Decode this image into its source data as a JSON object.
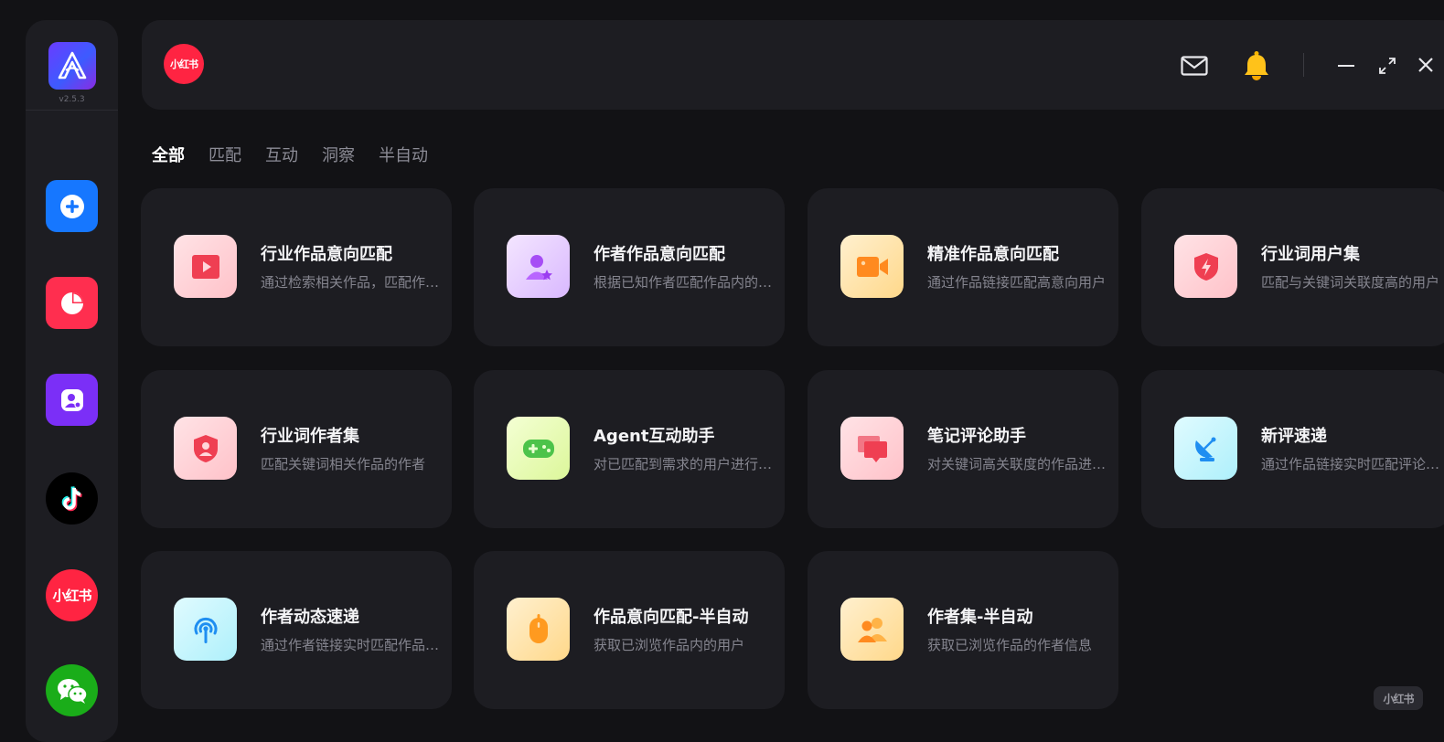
{
  "app": {
    "version": "v2.5.3",
    "brand_color": "#ff2442"
  },
  "sidebar": {
    "items": [
      {
        "name": "add",
        "icon": "plus-circle-icon",
        "color": "#1677ff"
      },
      {
        "name": "stats",
        "icon": "pie-chart-icon",
        "color": "#ff2e4f"
      },
      {
        "name": "user-settings",
        "icon": "user-gear-icon",
        "color": "#7b2ff7"
      },
      {
        "name": "douyin",
        "icon": "tiktok-icon",
        "color": "#000000"
      },
      {
        "name": "xiaohongshu",
        "label": "小红书",
        "icon": "xiaohongshu-logo",
        "color": "#ff2442"
      },
      {
        "name": "wechat",
        "icon": "wechat-icon",
        "color": "#1aad19"
      }
    ]
  },
  "header": {
    "platform_logo_text": "小红书",
    "icons": [
      "mail-icon",
      "bell-icon",
      "minimize-icon",
      "expand-icon",
      "close-icon"
    ]
  },
  "tabs": [
    {
      "label": "全部",
      "active": true
    },
    {
      "label": "匹配",
      "active": false
    },
    {
      "label": "互动",
      "active": false
    },
    {
      "label": "洞察",
      "active": false
    },
    {
      "label": "半自动",
      "active": false
    }
  ],
  "cards": [
    {
      "title": "行业作品意向匹配",
      "desc": "通过检索相关作品，匹配作品内的用户",
      "icon": "video-play-icon"
    },
    {
      "title": "作者作品意向匹配",
      "desc": "根据已知作者匹配作品内的用户",
      "icon": "user-star-icon"
    },
    {
      "title": "精准作品意向匹配",
      "desc": "通过作品链接匹配高意向用户",
      "icon": "video-camera-icon"
    },
    {
      "title": "行业词用户集",
      "desc": "匹配与关键词关联度高的用户",
      "icon": "shield-bolt-icon"
    },
    {
      "title": "行业词作者集",
      "desc": "匹配关键词相关作品的作者",
      "icon": "shield-user-icon"
    },
    {
      "title": "Agent互动助手",
      "desc": "对已匹配到需求的用户进行互动",
      "icon": "gamepad-icon"
    },
    {
      "title": "笔记评论助手",
      "desc": "对关键词高关联度的作品进行评论",
      "icon": "comment-icon"
    },
    {
      "title": "新评速递",
      "desc": "通过作品链接实时匹配评论用户",
      "icon": "satellite-dish-icon"
    },
    {
      "title": "作者动态速递",
      "desc": "通过作者链接实时匹配作品用户",
      "icon": "broadcast-icon"
    },
    {
      "title": "作品意向匹配-半自动",
      "desc": "获取已浏览作品内的用户",
      "icon": "mouse-icon"
    },
    {
      "title": "作者集-半自动",
      "desc": "获取已浏览作品的作者信息",
      "icon": "users-icon"
    }
  ],
  "watermark": {
    "text": "小红书"
  }
}
